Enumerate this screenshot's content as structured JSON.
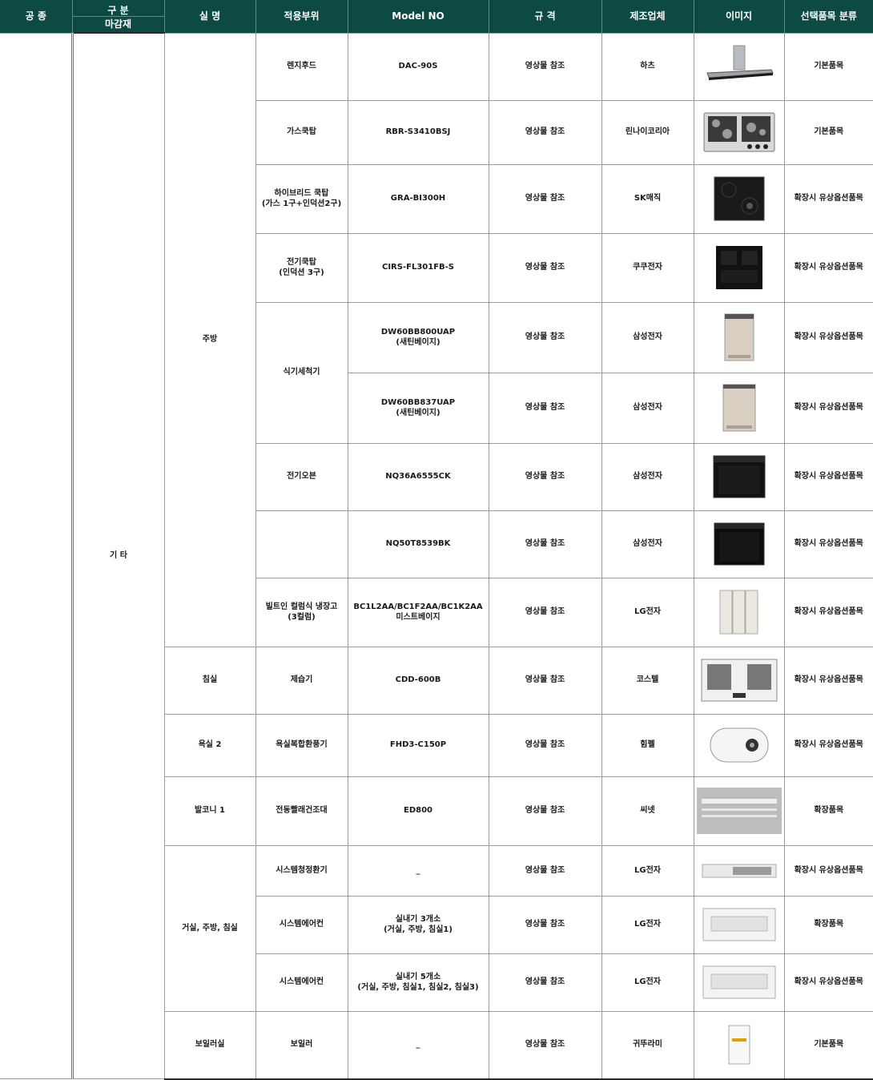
{
  "header": {
    "gongjong": "공 종",
    "gubun": "구 분",
    "magamjae": "마감재",
    "silmyeong": "실 명",
    "jeogyongbuwi": "적용부위",
    "model_no": "Model NO",
    "gyugyeok": "규 격",
    "jejoeopche": "제조업체",
    "imiji": "이미지",
    "seontaek": "선택품목 분류"
  },
  "category": "기 타",
  "rooms": {
    "kitchen": "주방",
    "bedroom": "침실",
    "bath2": "욕실 2",
    "balcony1": "발코니 1",
    "living": "거실, 주방, 침실",
    "boiler_room": "보일러실"
  },
  "dishwasher_part": "식기세척기",
  "rows": [
    {
      "part": "렌지후드",
      "model": "DAC-90S",
      "spec": "영상물 참조",
      "maker": "하츠",
      "class": "기본품목",
      "icon": "range-hood-icon"
    },
    {
      "part": "가스쿡탑",
      "model": "RBR-S3410BSJ",
      "spec": "영상물 참조",
      "maker": "린나이코리아",
      "class": "기본품목",
      "icon": "gas-cooktop-icon"
    },
    {
      "part": "하이브리드 쿡탑\n(가스 1구+인덕션2구)",
      "model": "GRA-BI300H",
      "spec": "영상물 참조",
      "maker": "SK매직",
      "class": "확장시 유상옵션품목",
      "icon": "hybrid-cooktop-icon"
    },
    {
      "part": "전기쿡탑\n(인덕션 3구)",
      "model": "CIRS-FL301FB-S",
      "spec": "영상물 참조",
      "maker": "쿠쿠전자",
      "class": "확장시 유상옵션품목",
      "icon": "induction-cooktop-icon"
    },
    {
      "part": "",
      "model": "DW60BB800UAP\n(새틴베이지)",
      "spec": "영상물 참조",
      "maker": "삼성전자",
      "class": "확장시 유상옵션품목",
      "icon": "dishwasher-icon"
    },
    {
      "part": "",
      "model": "DW60BB837UAP\n(새틴베이지)",
      "spec": "영상물 참조",
      "maker": "삼성전자",
      "class": "확장시 유상옵션품목",
      "icon": "dishwasher-icon"
    },
    {
      "part": "전기오븐",
      "model": "NQ36A6555CK",
      "spec": "영상물 참조",
      "maker": "삼성전자",
      "class": "확장시 유상옵션품목",
      "icon": "oven-icon"
    },
    {
      "part": "",
      "model": "NQ50T8539BK",
      "spec": "영상물 참조",
      "maker": "삼성전자",
      "class": "확장시 유상옵션품목",
      "icon": "oven-icon"
    },
    {
      "part": "빌트인 컬럼식 냉장고\n(3컬럼)",
      "model": "BC1L2AA/BC1F2AA/BC1K2AA\n미스트베이지",
      "spec": "영상물 참조",
      "maker": "LG전자",
      "class": "확장시 유상옵션품목",
      "icon": "refrigerator-icon"
    },
    {
      "part": "제습기",
      "model": "CDD-600B",
      "spec": "영상물 참조",
      "maker": "코스텔",
      "class": "확장시 유상옵션품목",
      "icon": "dehumidifier-icon"
    },
    {
      "part": "욕실복합환풍기",
      "model": "FHD3-C150P",
      "spec": "영상물 참조",
      "maker": "힘펠",
      "class": "확장시 유상옵션품목",
      "icon": "bath-fan-icon"
    },
    {
      "part": "전동빨래건조대",
      "model": "ED800",
      "spec": "영상물 참조",
      "maker": "씨넷",
      "class": "확장품목",
      "icon": "laundry-rack-icon"
    },
    {
      "part": "시스템청정환기",
      "model": "_",
      "spec": "영상물 참조",
      "maker": "LG전자",
      "class": "확장시 유상옵션품목",
      "icon": "ventilator-icon"
    },
    {
      "part": "시스템에어컨",
      "model": "실내기 3개소\n(거실, 주방, 침실1)",
      "spec": "영상물 참조",
      "maker": "LG전자",
      "class": "확장품목",
      "icon": "air-conditioner-icon"
    },
    {
      "part": "시스템에어컨",
      "model": "실내기 5개소\n(거실, 주방, 침실1, 침실2, 침실3)",
      "spec": "영상물 참조",
      "maker": "LG전자",
      "class": "확장시 유상옵션품목",
      "icon": "air-conditioner-icon"
    },
    {
      "part": "보일러",
      "model": "_",
      "spec": "영상물 참조",
      "maker": "귀뚜라미",
      "class": "기본품목",
      "icon": "boiler-icon"
    }
  ]
}
